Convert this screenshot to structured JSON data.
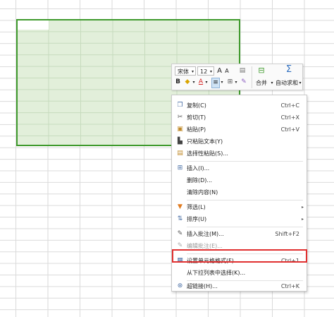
{
  "toolbar": {
    "font_name": "宋体",
    "font_size": "12",
    "grow_font": "A",
    "shrink_font": "A",
    "bold": "B",
    "font_color": "A",
    "merge_label": "合并",
    "autosum_label": "自动求和",
    "sigma": "Σ"
  },
  "menu": {
    "items": [
      {
        "label": "复制(C)",
        "shortcut": "Ctrl+C"
      },
      {
        "label": "剪切(T)",
        "shortcut": "Ctrl+X"
      },
      {
        "label": "粘贴(P)",
        "shortcut": "Ctrl+V"
      },
      {
        "label": "只粘贴文本(Y)",
        "shortcut": ""
      },
      {
        "label": "选择性粘贴(S)...",
        "shortcut": ""
      },
      {
        "label": "插入(I)...",
        "shortcut": ""
      },
      {
        "label": "删除(D)...",
        "shortcut": ""
      },
      {
        "label": "清除内容(N)",
        "shortcut": ""
      },
      {
        "label": "筛选(L)",
        "shortcut": ""
      },
      {
        "label": "排序(U)",
        "shortcut": ""
      },
      {
        "label": "插入批注(M)...",
        "shortcut": "Shift+F2"
      },
      {
        "label": "编辑批注(E)...",
        "shortcut": ""
      },
      {
        "label": "设置单元格格式(F)...",
        "shortcut": "Ctrl+1"
      },
      {
        "label": "从下拉列表中选择(K)...",
        "shortcut": ""
      },
      {
        "label": "超链接(H)...",
        "shortcut": "Ctrl+K"
      }
    ]
  },
  "colors": {
    "selection_fill": "#e2efda",
    "selection_border": "#3f9a2d",
    "highlight": "#e03030"
  }
}
